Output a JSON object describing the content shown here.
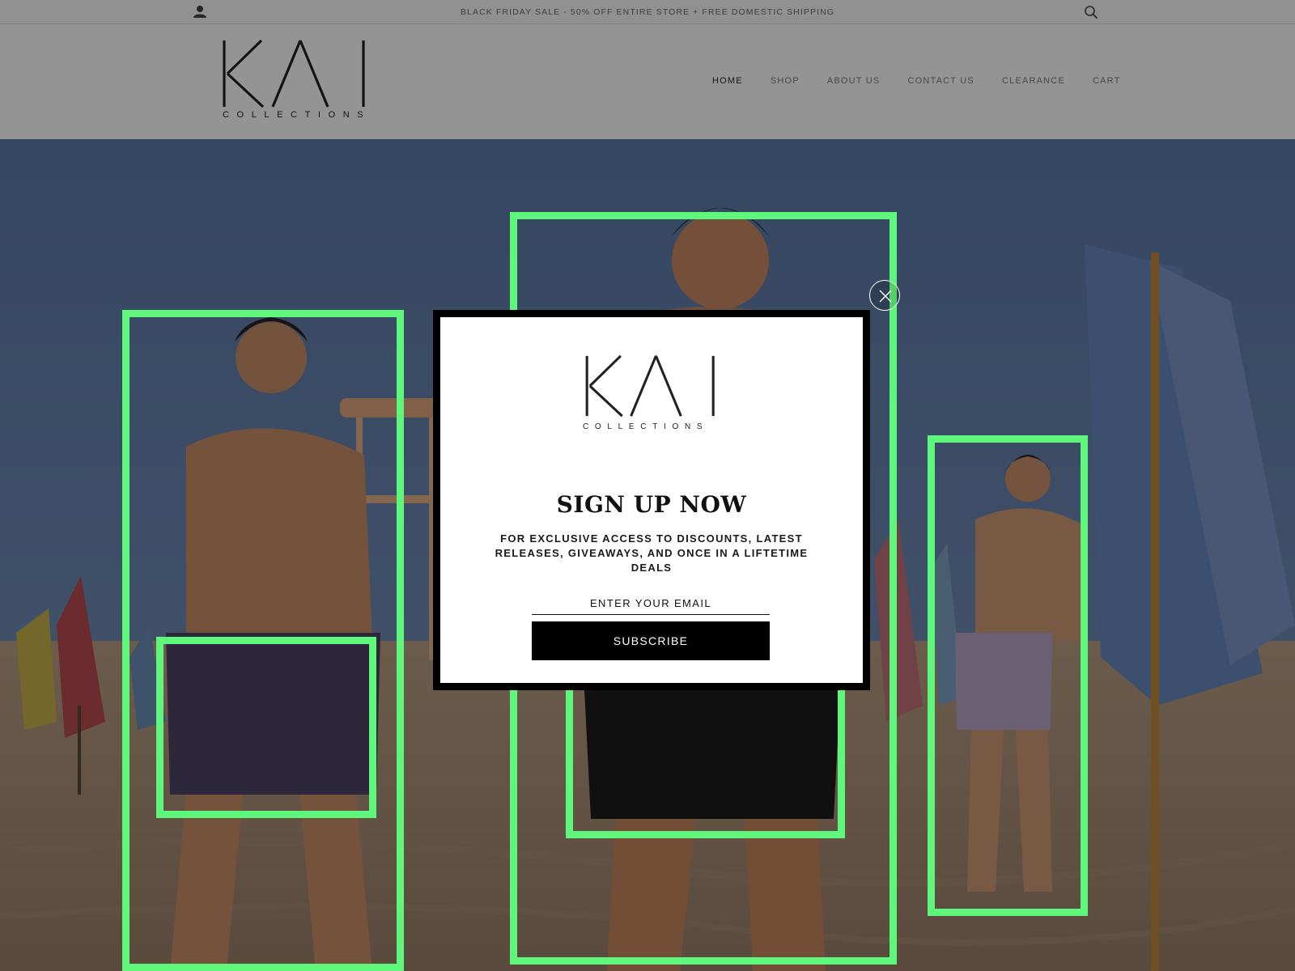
{
  "announcement": {
    "text": "BLACK FRIDAY SALE - 50% OFF ENTIRE STORE + FREE DOMESTIC SHIPPING",
    "account_icon": "user-icon",
    "search_icon": "search-icon"
  },
  "brand": {
    "name": "KAI",
    "tagline": "COLLECTIONS"
  },
  "nav": {
    "items": [
      {
        "label": "HOME",
        "active": true
      },
      {
        "label": "SHOP"
      },
      {
        "label": "ABOUT US"
      },
      {
        "label": "CONTACT US"
      },
      {
        "label": "CLEARANCE"
      },
      {
        "label": "CART"
      }
    ]
  },
  "popup": {
    "brand_name": "KAI",
    "brand_tagline": "COLLECTIONS",
    "title": "SIGN UP NOW",
    "description": "FOR EXCLUSIVE ACCESS TO DISCOUNTS, LATEST RELEASES, GIVEAWAYS, AND ONCE IN A LIFTETIME DEALS",
    "email_placeholder": "ENTER YOUR EMAIL",
    "subscribe_label": "SUBSCRIBE",
    "close_icon": "close-icon"
  },
  "colors": {
    "highlight": "#5ef77c",
    "popup_border": "#000000",
    "button": "#000000"
  }
}
